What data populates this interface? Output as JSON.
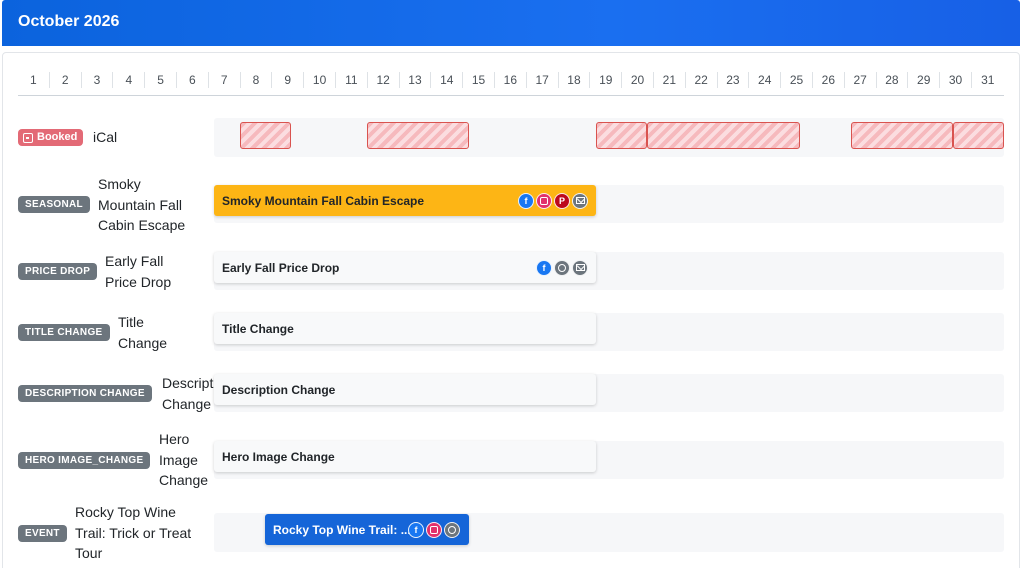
{
  "header": {
    "title": "October 2026"
  },
  "days": [
    "1",
    "2",
    "3",
    "4",
    "5",
    "6",
    "7",
    "8",
    "9",
    "10",
    "11",
    "12",
    "13",
    "14",
    "15",
    "16",
    "17",
    "18",
    "19",
    "20",
    "21",
    "22",
    "23",
    "24",
    "25",
    "26",
    "27",
    "28",
    "29",
    "30",
    "31"
  ],
  "colors": {
    "header": "#1a6ff0",
    "booked": "#e36a76",
    "seasonal": "#fdb515",
    "event": "#1565d8",
    "badge": "#6c757d"
  },
  "booked_row": {
    "badge": "Booked",
    "label": "iCal",
    "icon": "calendar-icon"
  },
  "rows": [
    {
      "badge": "SEASONAL",
      "label_lines": [
        "Smoky",
        "Mountain Fall",
        "Cabin Escape"
      ],
      "bar": "Smoky Mountain Fall Cabin Escape",
      "icons": [
        "facebook-icon",
        "instagram-icon",
        "pinterest-icon",
        "email-icon"
      ]
    },
    {
      "badge": "PRICE DROP",
      "label_lines": [
        "Early Fall",
        "Price Drop"
      ],
      "bar": "Early Fall Price Drop",
      "icons": [
        "facebook-icon",
        "circle-icon",
        "email-icon"
      ]
    },
    {
      "badge": "TITLE CHANGE",
      "label_lines": [
        "Title",
        "Change"
      ],
      "bar": "Title Change"
    },
    {
      "badge": "DESCRIPTION CHANGE",
      "label_lines": [
        "Descript",
        "Change"
      ],
      "bar": "Description Change"
    },
    {
      "badge": "HERO IMAGE_CHANGE",
      "label_lines": [
        "Hero",
        "Image",
        "Change"
      ],
      "bar": "Hero Image Change"
    },
    {
      "badge": "EVENT",
      "label_lines": [
        "Rocky Top Wine",
        "Trail: Trick or Treat",
        "Tour"
      ],
      "bar": "Rocky Top Wine Trail: ...",
      "icons": [
        "facebook-icon",
        "instagram-icon",
        "circle-icon"
      ]
    }
  ]
}
